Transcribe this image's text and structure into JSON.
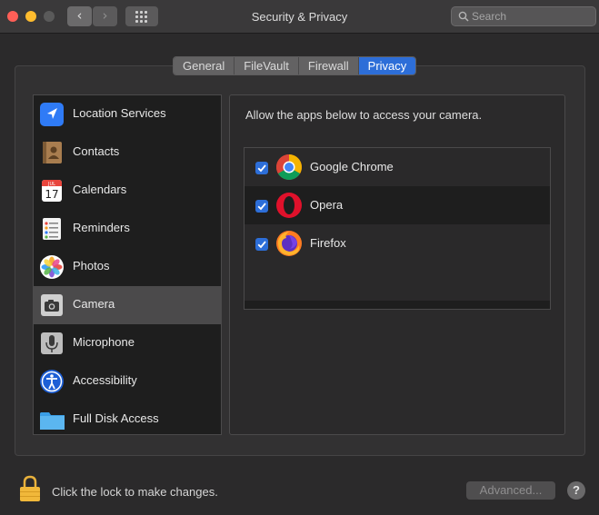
{
  "window": {
    "title": "Security & Privacy"
  },
  "toolbar": {
    "back_glyph": "‹",
    "forward_glyph": "›",
    "search_placeholder": "Search"
  },
  "tabs": [
    {
      "label": "General",
      "active": false
    },
    {
      "label": "FileVault",
      "active": false
    },
    {
      "label": "Firewall",
      "active": false
    },
    {
      "label": "Privacy",
      "active": true
    }
  ],
  "sidebar": {
    "items": [
      {
        "label": "Location Services",
        "icon": "location-arrow-icon"
      },
      {
        "label": "Contacts",
        "icon": "contacts-book-icon"
      },
      {
        "label": "Calendars",
        "icon": "calendar-icon",
        "month": "JUL",
        "day": "17"
      },
      {
        "label": "Reminders",
        "icon": "reminders-list-icon"
      },
      {
        "label": "Photos",
        "icon": "photos-flower-icon"
      },
      {
        "label": "Camera",
        "icon": "camera-icon",
        "selected": true
      },
      {
        "label": "Microphone",
        "icon": "microphone-icon"
      },
      {
        "label": "Accessibility",
        "icon": "accessibility-icon"
      },
      {
        "label": "Full Disk Access",
        "icon": "folder-icon"
      }
    ]
  },
  "main": {
    "description": "Allow the apps below to access your camera.",
    "apps": [
      {
        "name": "Google Chrome",
        "checked": true,
        "icon": "chrome-icon"
      },
      {
        "name": "Opera",
        "checked": true,
        "icon": "opera-icon"
      },
      {
        "name": "Firefox",
        "checked": true,
        "icon": "firefox-icon"
      }
    ]
  },
  "footer": {
    "lock_text": "Click the lock to make changes.",
    "advanced_label": "Advanced...",
    "help_label": "?"
  },
  "colors": {
    "accent": "#2d6ed8",
    "selected_row": "#4b4a4b"
  }
}
